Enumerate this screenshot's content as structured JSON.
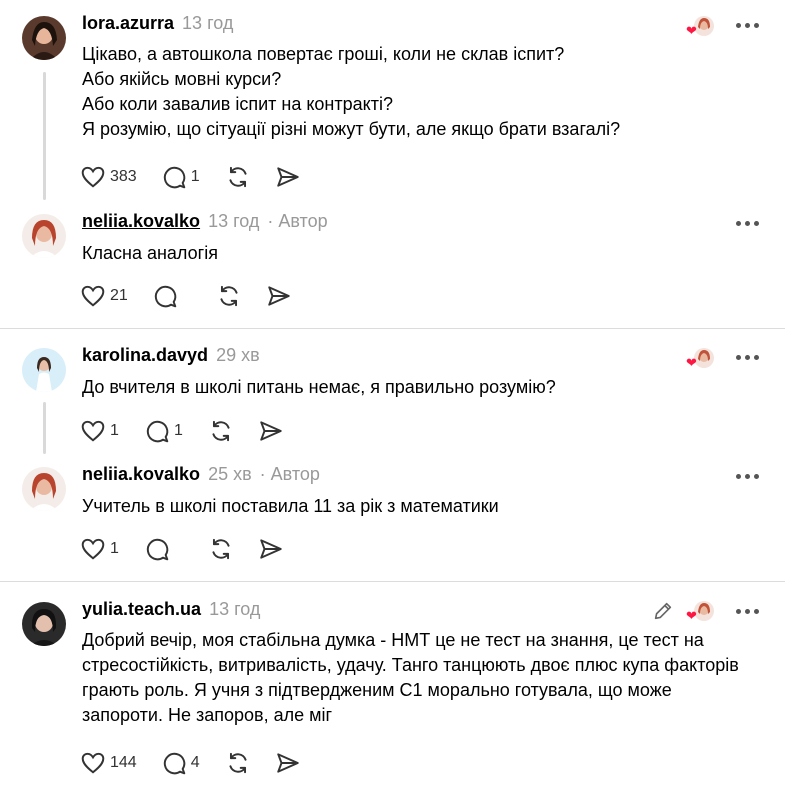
{
  "posts": [
    {
      "username": "lora.azurra",
      "time": "13 год",
      "lines": [
        "Цікаво, а автошкола повертає гроші, коли не склав іспит?",
        "Або якійсь мовні курси?",
        "Або коли завалив іспит на контракті?",
        "Я розумію, що сітуації різні можут бути, але якщо брати взагалі?"
      ],
      "likes": "383",
      "replies": "1"
    },
    {
      "username": "neliia.kovalko",
      "time": "13 год",
      "author": "· Автор",
      "lines": [
        "Класна аналогія"
      ],
      "likes": "21",
      "replies": ""
    },
    {
      "username": "karolina.davyd",
      "time": "29 хв",
      "lines": [
        "До вчителя в школі питань немає, я правильно розумію?"
      ],
      "likes": "1",
      "replies": "1"
    },
    {
      "username": "neliia.kovalko",
      "time": "25 хв",
      "author": "· Автор",
      "lines": [
        "Учитель в школі поставила 11 за рік з математики"
      ],
      "likes": "1",
      "replies": ""
    },
    {
      "username": "yulia.teach.ua",
      "time": "13 год",
      "lines": [
        "Добрий вечір, моя стабільна думка - НМТ це не тест на знання, це тест на",
        "стресостійкість, витривалість, удачу. Танго танцюють двоє плюс купа факторів",
        "грають роль. Я учня з підтвердженим С1 морально готувала, що може",
        "запороти. Не запоров, але міг"
      ],
      "likes": "144",
      "replies": "4"
    }
  ],
  "icons": {
    "like": "heart-icon",
    "reply": "comment-icon",
    "repost": "repost-icon",
    "share": "send-icon",
    "more": "more-icon",
    "liked_by_author": "liked-by-author-icon",
    "edit": "pencil-icon"
  },
  "colors": {
    "text": "#000000",
    "muted": "#999999",
    "icon": "#333333",
    "divider": "#dcdcdc",
    "thread_line": "#d9d9d9",
    "heart": "#ff1744"
  }
}
